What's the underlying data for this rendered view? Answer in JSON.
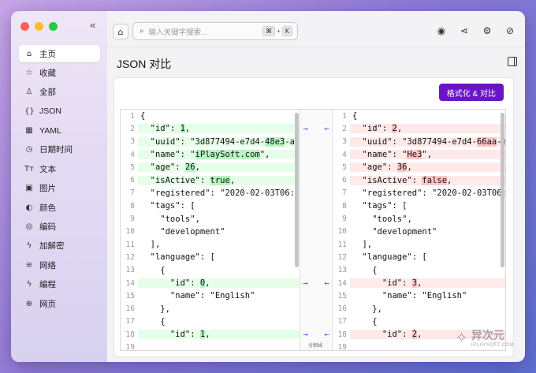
{
  "sidebar": {
    "items": [
      {
        "label": "主页",
        "icon": "⌂",
        "icon_name": "home-icon",
        "active": true
      },
      {
        "label": "收藏",
        "icon": "☆",
        "icon_name": "star-icon"
      },
      {
        "label": "全部",
        "icon": "♙",
        "icon_name": "bell-icon"
      },
      {
        "label": "JSON",
        "icon": "{}",
        "icon_name": "json-icon"
      },
      {
        "label": "YAML",
        "icon": "▦",
        "icon_name": "grid-icon"
      },
      {
        "label": "日期时间",
        "icon": "◷",
        "icon_name": "clock-icon"
      },
      {
        "label": "文本",
        "icon": "Tт",
        "icon_name": "text-icon"
      },
      {
        "label": "图片",
        "icon": "▣",
        "icon_name": "image-icon"
      },
      {
        "label": "颜色",
        "icon": "◐",
        "icon_name": "palette-icon"
      },
      {
        "label": "编码",
        "icon": "◎",
        "icon_name": "encode-icon"
      },
      {
        "label": "加解密",
        "icon": "ϟ",
        "icon_name": "crypto-icon"
      },
      {
        "label": "网络",
        "icon": "≋",
        "icon_name": "wifi-icon"
      },
      {
        "label": "编程",
        "icon": "ϟ",
        "icon_name": "code-icon"
      },
      {
        "label": "网页",
        "icon": "⊕",
        "icon_name": "globe-icon"
      }
    ],
    "collapse_icon": "«"
  },
  "toolbar": {
    "home_icon": "⌂",
    "search_placeholder": "输入关键字搜索...",
    "shortcut_key1": "⌘",
    "shortcut_plus": "+",
    "shortcut_key2": "K",
    "right_icons": [
      {
        "glyph": "◉",
        "name": "wechat-icon"
      },
      {
        "glyph": "⋖",
        "name": "share-icon"
      },
      {
        "glyph": "⚙",
        "name": "gear-icon"
      },
      {
        "glyph": "⊘",
        "name": "plugin-icon"
      }
    ]
  },
  "page": {
    "title": "JSON 对比",
    "format_button": "格式化 & 对比"
  },
  "diff": {
    "left": [
      {
        "n": "1",
        "t": "{",
        "s": ""
      },
      {
        "n": "2",
        "pre": "  \"id\": ",
        "hl": "1",
        "post": ",",
        "s": "add"
      },
      {
        "n": "3",
        "pre": "  \"uuid\": \"3d877494-e7d4-",
        "hl": "48e3",
        "post": "-a",
        "s": "add"
      },
      {
        "n": "4",
        "pre": "  \"name\": \"",
        "hl": "iPlaySoft.com",
        "post": "\",",
        "s": "add"
      },
      {
        "n": "5",
        "pre": "  \"age\": ",
        "hl": "26",
        "post": ",",
        "s": "add"
      },
      {
        "n": "6",
        "pre": "  \"isActive\": ",
        "hl": "true",
        "post": ",",
        "s": "add"
      },
      {
        "n": "7",
        "t": "  \"registered\": \"2020-02-03T06:",
        "s": ""
      },
      {
        "n": "8",
        "t": "  \"tags\": [",
        "s": ""
      },
      {
        "n": "9",
        "t": "    \"tools\",",
        "s": ""
      },
      {
        "n": "10",
        "t": "    \"development\"",
        "s": ""
      },
      {
        "n": "11",
        "t": "  ],",
        "s": ""
      },
      {
        "n": "12",
        "t": "  \"language\": [",
        "s": ""
      },
      {
        "n": "13",
        "t": "    {",
        "s": ""
      },
      {
        "n": "14",
        "pre": "      \"id\": ",
        "hl": "0",
        "post": ",",
        "s": "add"
      },
      {
        "n": "15",
        "t": "      \"name\": \"English\"",
        "s": ""
      },
      {
        "n": "16",
        "t": "    },",
        "s": ""
      },
      {
        "n": "17",
        "t": "    {",
        "s": ""
      },
      {
        "n": "18",
        "pre": "      \"id\": ",
        "hl": "1",
        "post": ",",
        "s": "add"
      },
      {
        "n": "19",
        "t": "",
        "s": ""
      }
    ],
    "right": [
      {
        "n": "1",
        "t": "{",
        "s": ""
      },
      {
        "n": "2",
        "pre": "  \"id\": ",
        "hl": "2",
        "post": ",",
        "s": "del"
      },
      {
        "n": "3",
        "pre": "  \"uuid\": \"3d877494-e7d4-",
        "hl": "66aa",
        "post": "-a",
        "s": "del"
      },
      {
        "n": "4",
        "pre": "  \"name\": \"",
        "hl": "He3",
        "post": "\",",
        "s": "del"
      },
      {
        "n": "5",
        "pre": "  \"age\": ",
        "hl": "36",
        "post": ",",
        "s": "del"
      },
      {
        "n": "6",
        "pre": "  \"isActive\": ",
        "hl": "false",
        "post": ",",
        "s": "del"
      },
      {
        "n": "7",
        "t": "  \"registered\": \"2020-02-03T06:",
        "s": ""
      },
      {
        "n": "8",
        "t": "  \"tags\": [",
        "s": ""
      },
      {
        "n": "9",
        "t": "    \"tools\",",
        "s": ""
      },
      {
        "n": "10",
        "t": "    \"development\"",
        "s": ""
      },
      {
        "n": "11",
        "t": "  ],",
        "s": ""
      },
      {
        "n": "12",
        "t": "  \"language\": [",
        "s": ""
      },
      {
        "n": "13",
        "t": "    {",
        "s": ""
      },
      {
        "n": "14",
        "pre": "      \"id\": ",
        "hl": "3",
        "post": ",",
        "s": "del"
      },
      {
        "n": "15",
        "t": "      \"name\": \"English\"",
        "s": ""
      },
      {
        "n": "16",
        "t": "    },",
        "s": ""
      },
      {
        "n": "17",
        "t": "    {",
        "s": ""
      },
      {
        "n": "18",
        "pre": "      \"id\": ",
        "hl": "2",
        "post": ",",
        "s": "del"
      },
      {
        "n": "19",
        "t": "",
        "s": ""
      }
    ],
    "mid_marks": [
      {
        "line": 2,
        "left": "→",
        "right": "←"
      },
      {
        "line": 14,
        "left": "→",
        "right": "←"
      },
      {
        "line": 18,
        "left": "→",
        "right": "←"
      }
    ],
    "mid_label": "分割线"
  },
  "watermark": {
    "logo": "✧",
    "cn": "异次元",
    "en": "IPLAYSOFT.COM"
  }
}
